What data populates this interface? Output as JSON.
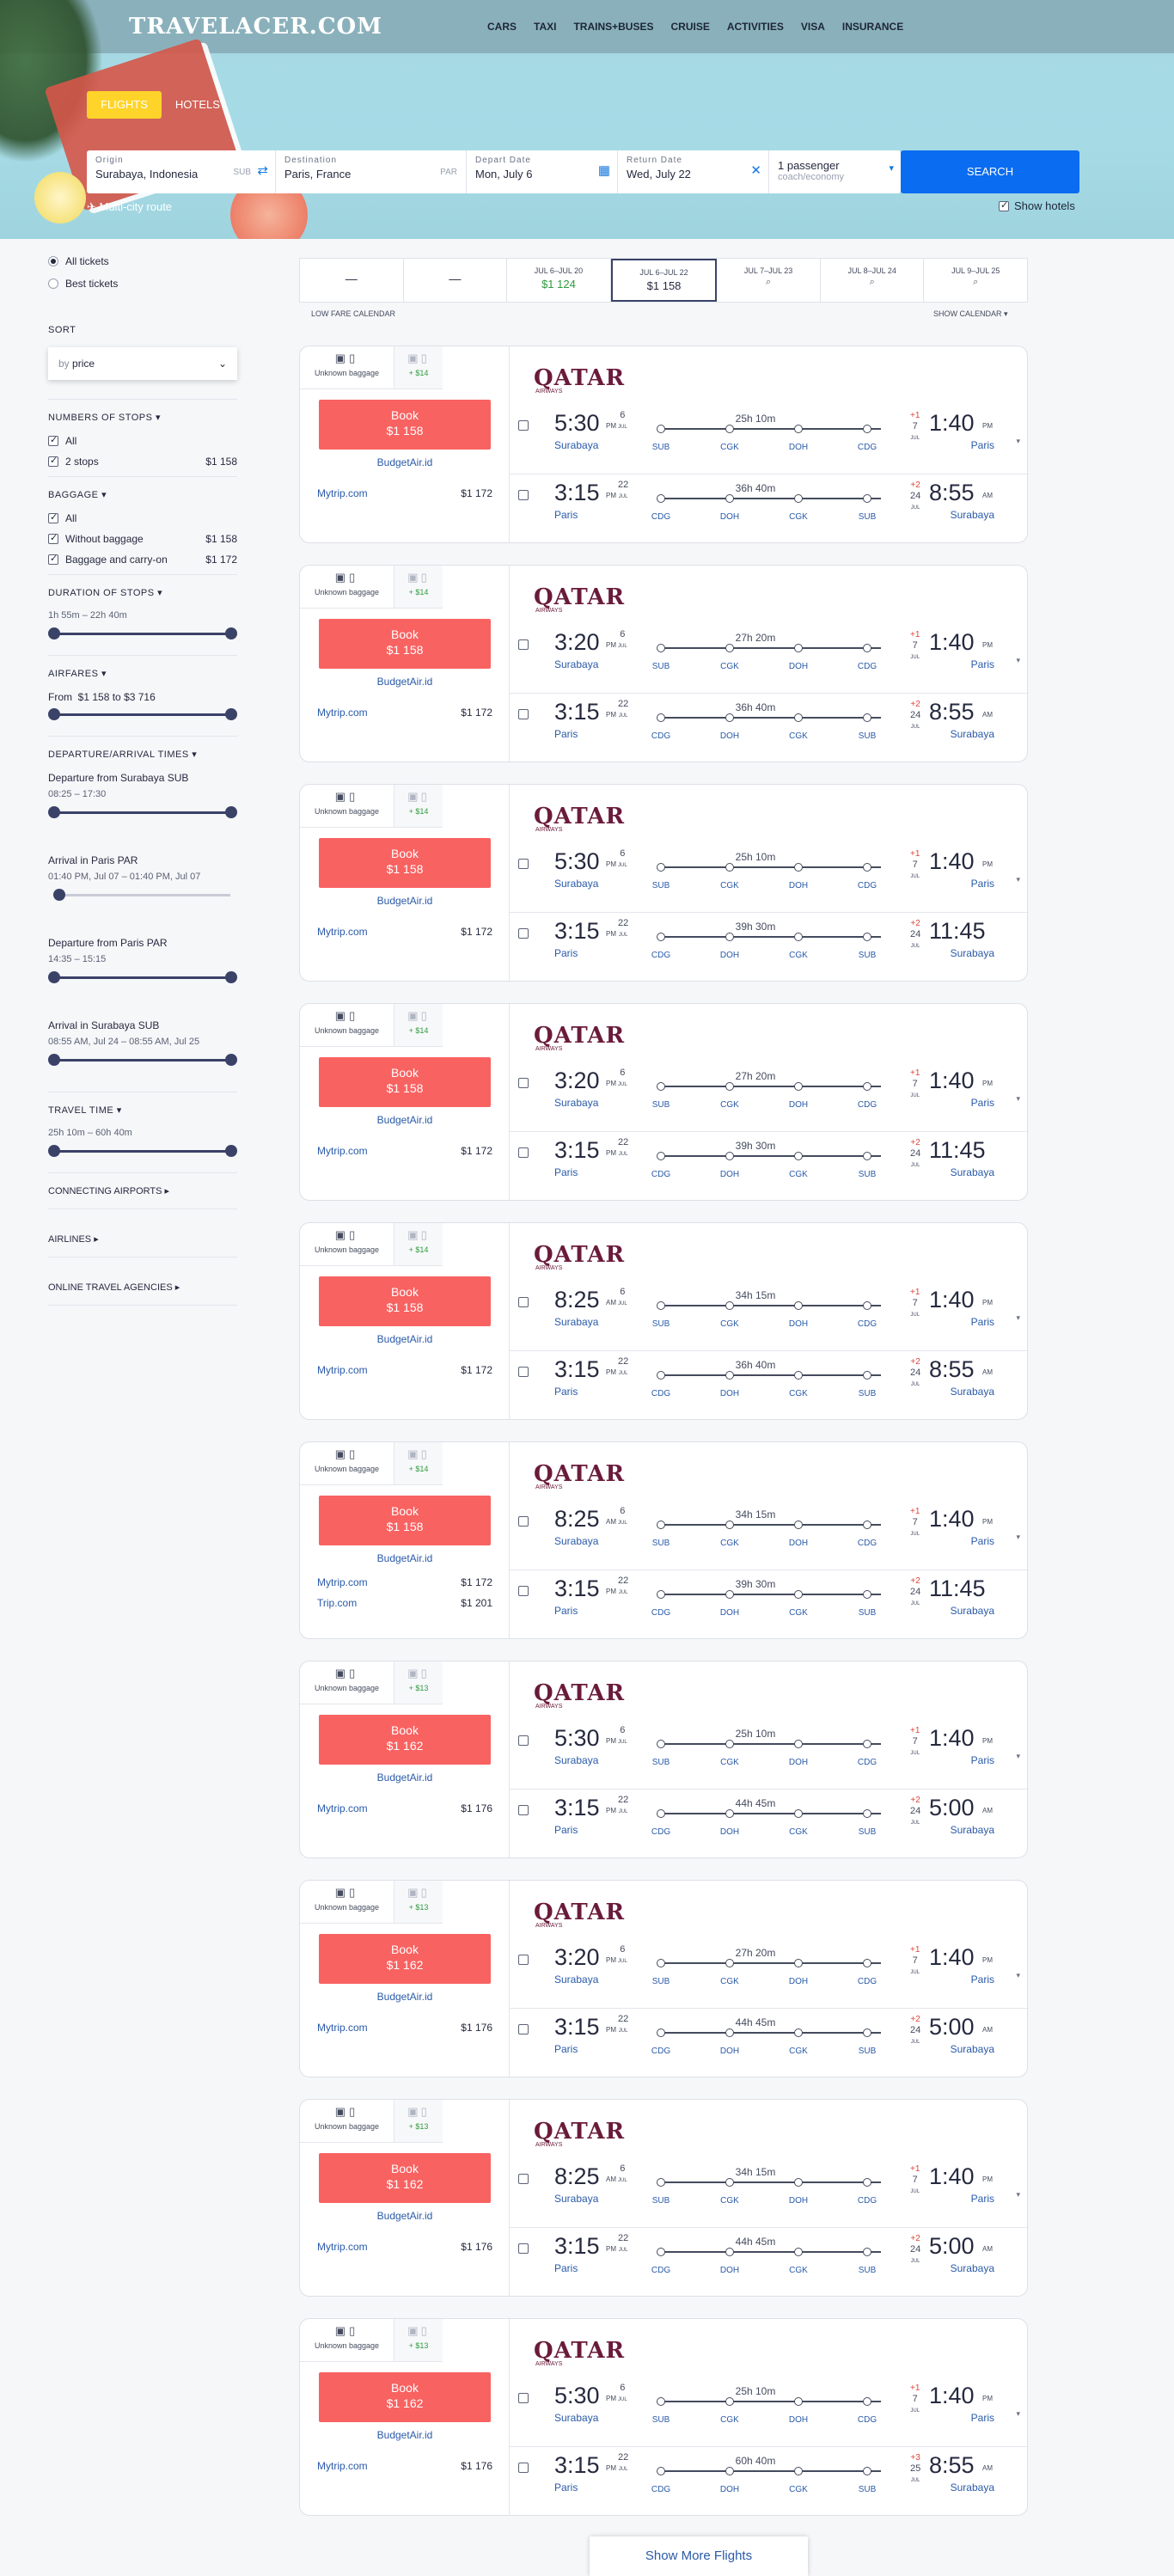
{
  "brand": {
    "logo": "TRAVELACER.COM"
  },
  "nav": [
    "CARS",
    "TAXI",
    "TRAINS+BUSES",
    "CRUISE",
    "ACTIVITIES",
    "VISA",
    "INSURANCE"
  ],
  "tabs": [
    {
      "label": "FLIGHTS",
      "active": true
    },
    {
      "label": "HOTELS",
      "active": false
    }
  ],
  "search": {
    "origin_label": "Origin",
    "origin_value": "Surabaya, Indonesia",
    "origin_code": "SUB",
    "destination_label": "Destination",
    "destination_value": "Paris, France",
    "destination_code": "PAR",
    "depart_label": "Depart Date",
    "depart_value": "Mon, July 6",
    "return_label": "Return Date",
    "return_value": "Wed, July 22",
    "passengers_value": "1 passenger",
    "class_value": "coach/economy",
    "search_label": "SEARCH",
    "multicity_label": "Multi-city route",
    "show_hotels_label": "Show hotels",
    "accent": "#0a6cf0"
  },
  "sidebar": {
    "ticket_types": [
      {
        "label": "All tickets",
        "selected": true
      },
      {
        "label": "Best tickets",
        "selected": false
      }
    ],
    "sort_heading": "SORT",
    "sort_prefix": "by",
    "sort_value": "price",
    "stops_heading": "NUMBERS OF STOPS",
    "stops": [
      {
        "label": "All",
        "price": ""
      },
      {
        "label": "2 stops",
        "price": "$1 158"
      }
    ],
    "baggage_heading": "BAGGAGE",
    "baggage": [
      {
        "label": "All",
        "price": ""
      },
      {
        "label": "Without baggage",
        "price": "$1 158"
      },
      {
        "label": "Baggage and carry-on",
        "price": "$1 172"
      }
    ],
    "duration_heading": "DURATION OF STOPS",
    "duration_range": "1h 55m – 22h 40m",
    "airfares_heading": "AIRFARES",
    "airfares_from": "From",
    "airfares_min": "$1 158",
    "airfares_to": "to",
    "airfares_max": "$3 716",
    "times_heading": "DEPARTURE/ARRIVAL TIMES",
    "time_filters": [
      {
        "label": "Departure from Surabaya SUB",
        "range": "08:25 – 17:30"
      },
      {
        "label": "Arrival in Paris PAR",
        "range": "01:40 PM, Jul 07 – 01:40 PM, Jul 07"
      },
      {
        "label": "Departure from Paris PAR",
        "range": "14:35 – 15:15"
      },
      {
        "label": "Arrival in Surabaya SUB",
        "range": "08:55 AM, Jul 24 – 08:55 AM, Jul 25"
      }
    ],
    "travel_time_heading": "TRAVEL TIME",
    "travel_time_range": "25h 10m – 60h 40m",
    "connecting_heading": "CONNECTING AIRPORTS",
    "airlines_heading": "AIRLINES",
    "agencies_heading": "ONLINE TRAVEL AGENCIES"
  },
  "calendar": {
    "cells": [
      {
        "date": "",
        "price": "—",
        "type": "dash"
      },
      {
        "date": "",
        "price": "—",
        "type": "dash"
      },
      {
        "date": "JUL 6–JUL 20",
        "price": "$1 124",
        "type": "green"
      },
      {
        "date": "JUL 6–JUL 22",
        "price": "$1 158",
        "type": "selected"
      },
      {
        "date": "JUL 7–JUL 23",
        "price": "",
        "type": "search"
      },
      {
        "date": "JUL 8–JUL 24",
        "price": "",
        "type": "search"
      },
      {
        "date": "JUL 9–JUL 25",
        "price": "",
        "type": "search"
      }
    ],
    "low_fare_label": "LOW FARE CALENDAR",
    "show_calendar_label": "SHOW CALENDAR"
  },
  "card_common": {
    "baggage_label": "Unknown baggage",
    "book_label": "Book",
    "airline_name": "QATAR",
    "airline_sub": "AIRWAYS"
  },
  "flights": [
    {
      "extra": "+ $14",
      "price": "$1 158",
      "agency": "BudgetAir.id",
      "others": [
        {
          "name": "Mytrip.com",
          "price": "$1 172"
        }
      ],
      "out": {
        "dep": "5:30",
        "dep_ampm": "PM",
        "dep_day": "6",
        "dep_city": "Surabaya",
        "dur": "25h 10m",
        "stops": [
          "SUB",
          "CGK",
          "DOH",
          "CDG"
        ],
        "arr_plus": "+1",
        "arr_day": "7",
        "arr": "1:40",
        "arr_ampm": "PM",
        "arr_city": "Paris"
      },
      "ret": {
        "dep": "3:15",
        "dep_ampm": "PM",
        "dep_day": "22",
        "dep_city": "Paris",
        "dur": "36h 40m",
        "stops": [
          "CDG",
          "DOH",
          "CGK",
          "SUB"
        ],
        "arr_plus": "+2",
        "arr_day": "24",
        "arr": "8:55",
        "arr_ampm": "AM",
        "arr_city": "Surabaya"
      }
    },
    {
      "extra": "+ $14",
      "price": "$1 158",
      "agency": "BudgetAir.id",
      "others": [
        {
          "name": "Mytrip.com",
          "price": "$1 172"
        }
      ],
      "out": {
        "dep": "3:20",
        "dep_ampm": "PM",
        "dep_day": "6",
        "dep_city": "Surabaya",
        "dur": "27h 20m",
        "stops": [
          "SUB",
          "CGK",
          "DOH",
          "CDG"
        ],
        "arr_plus": "+1",
        "arr_day": "7",
        "arr": "1:40",
        "arr_ampm": "PM",
        "arr_city": "Paris"
      },
      "ret": {
        "dep": "3:15",
        "dep_ampm": "PM",
        "dep_day": "22",
        "dep_city": "Paris",
        "dur": "36h 40m",
        "stops": [
          "CDG",
          "DOH",
          "CGK",
          "SUB"
        ],
        "arr_plus": "+2",
        "arr_day": "24",
        "arr": "8:55",
        "arr_ampm": "AM",
        "arr_city": "Surabaya"
      }
    },
    {
      "extra": "+ $14",
      "price": "$1 158",
      "agency": "BudgetAir.id",
      "others": [
        {
          "name": "Mytrip.com",
          "price": "$1 172"
        }
      ],
      "out": {
        "dep": "5:30",
        "dep_ampm": "PM",
        "dep_day": "6",
        "dep_city": "Surabaya",
        "dur": "25h 10m",
        "stops": [
          "SUB",
          "CGK",
          "DOH",
          "CDG"
        ],
        "arr_plus": "+1",
        "arr_day": "7",
        "arr": "1:40",
        "arr_ampm": "PM",
        "arr_city": "Paris"
      },
      "ret": {
        "dep": "3:15",
        "dep_ampm": "PM",
        "dep_day": "22",
        "dep_city": "Paris",
        "dur": "39h 30m",
        "stops": [
          "CDG",
          "DOH",
          "CGK",
          "SUB"
        ],
        "arr_plus": "+2",
        "arr_day": "24",
        "arr": "11:45",
        "arr_ampm": "",
        "arr_city": "Surabaya"
      }
    },
    {
      "extra": "+ $14",
      "price": "$1 158",
      "agency": "BudgetAir.id",
      "others": [
        {
          "name": "Mytrip.com",
          "price": "$1 172"
        }
      ],
      "out": {
        "dep": "3:20",
        "dep_ampm": "PM",
        "dep_day": "6",
        "dep_city": "Surabaya",
        "dur": "27h 20m",
        "stops": [
          "SUB",
          "CGK",
          "DOH",
          "CDG"
        ],
        "arr_plus": "+1",
        "arr_day": "7",
        "arr": "1:40",
        "arr_ampm": "PM",
        "arr_city": "Paris"
      },
      "ret": {
        "dep": "3:15",
        "dep_ampm": "PM",
        "dep_day": "22",
        "dep_city": "Paris",
        "dur": "39h 30m",
        "stops": [
          "CDG",
          "DOH",
          "CGK",
          "SUB"
        ],
        "arr_plus": "+2",
        "arr_day": "24",
        "arr": "11:45",
        "arr_ampm": "",
        "arr_city": "Surabaya"
      }
    },
    {
      "extra": "+ $14",
      "price": "$1 158",
      "agency": "BudgetAir.id",
      "others": [
        {
          "name": "Mytrip.com",
          "price": "$1 172"
        }
      ],
      "out": {
        "dep": "8:25",
        "dep_ampm": "AM",
        "dep_day": "6",
        "dep_city": "Surabaya",
        "dur": "34h 15m",
        "stops": [
          "SUB",
          "CGK",
          "DOH",
          "CDG"
        ],
        "arr_plus": "+1",
        "arr_day": "7",
        "arr": "1:40",
        "arr_ampm": "PM",
        "arr_city": "Paris"
      },
      "ret": {
        "dep": "3:15",
        "dep_ampm": "PM",
        "dep_day": "22",
        "dep_city": "Paris",
        "dur": "36h 40m",
        "stops": [
          "CDG",
          "DOH",
          "CGK",
          "SUB"
        ],
        "arr_plus": "+2",
        "arr_day": "24",
        "arr": "8:55",
        "arr_ampm": "AM",
        "arr_city": "Surabaya"
      }
    },
    {
      "extra": "+ $14",
      "price": "$1 158",
      "agency": "BudgetAir.id",
      "others": [
        {
          "name": "Mytrip.com",
          "price": "$1 172"
        },
        {
          "name": "Trip.com",
          "price": "$1 201"
        }
      ],
      "out": {
        "dep": "8:25",
        "dep_ampm": "AM",
        "dep_day": "6",
        "dep_city": "Surabaya",
        "dur": "34h 15m",
        "stops": [
          "SUB",
          "CGK",
          "DOH",
          "CDG"
        ],
        "arr_plus": "+1",
        "arr_day": "7",
        "arr": "1:40",
        "arr_ampm": "PM",
        "arr_city": "Paris"
      },
      "ret": {
        "dep": "3:15",
        "dep_ampm": "PM",
        "dep_day": "22",
        "dep_city": "Paris",
        "dur": "39h 30m",
        "stops": [
          "CDG",
          "DOH",
          "CGK",
          "SUB"
        ],
        "arr_plus": "+2",
        "arr_day": "24",
        "arr": "11:45",
        "arr_ampm": "",
        "arr_city": "Surabaya"
      }
    },
    {
      "extra": "+ $13",
      "price": "$1 162",
      "agency": "BudgetAir.id",
      "others": [
        {
          "name": "Mytrip.com",
          "price": "$1 176"
        }
      ],
      "out": {
        "dep": "5:30",
        "dep_ampm": "PM",
        "dep_day": "6",
        "dep_city": "Surabaya",
        "dur": "25h 10m",
        "stops": [
          "SUB",
          "CGK",
          "DOH",
          "CDG"
        ],
        "arr_plus": "+1",
        "arr_day": "7",
        "arr": "1:40",
        "arr_ampm": "PM",
        "arr_city": "Paris"
      },
      "ret": {
        "dep": "3:15",
        "dep_ampm": "PM",
        "dep_day": "22",
        "dep_city": "Paris",
        "dur": "44h 45m",
        "stops": [
          "CDG",
          "DOH",
          "CGK",
          "SUB"
        ],
        "arr_plus": "+2",
        "arr_day": "24",
        "arr": "5:00",
        "arr_ampm": "AM",
        "arr_city": "Surabaya"
      }
    },
    {
      "extra": "+ $13",
      "price": "$1 162",
      "agency": "BudgetAir.id",
      "others": [
        {
          "name": "Mytrip.com",
          "price": "$1 176"
        }
      ],
      "out": {
        "dep": "3:20",
        "dep_ampm": "PM",
        "dep_day": "6",
        "dep_city": "Surabaya",
        "dur": "27h 20m",
        "stops": [
          "SUB",
          "CGK",
          "DOH",
          "CDG"
        ],
        "arr_plus": "+1",
        "arr_day": "7",
        "arr": "1:40",
        "arr_ampm": "PM",
        "arr_city": "Paris"
      },
      "ret": {
        "dep": "3:15",
        "dep_ampm": "PM",
        "dep_day": "22",
        "dep_city": "Paris",
        "dur": "44h 45m",
        "stops": [
          "CDG",
          "DOH",
          "CGK",
          "SUB"
        ],
        "arr_plus": "+2",
        "arr_day": "24",
        "arr": "5:00",
        "arr_ampm": "AM",
        "arr_city": "Surabaya"
      }
    },
    {
      "extra": "+ $13",
      "price": "$1 162",
      "agency": "BudgetAir.id",
      "others": [
        {
          "name": "Mytrip.com",
          "price": "$1 176"
        }
      ],
      "out": {
        "dep": "8:25",
        "dep_ampm": "AM",
        "dep_day": "6",
        "dep_city": "Surabaya",
        "dur": "34h 15m",
        "stops": [
          "SUB",
          "CGK",
          "DOH",
          "CDG"
        ],
        "arr_plus": "+1",
        "arr_day": "7",
        "arr": "1:40",
        "arr_ampm": "PM",
        "arr_city": "Paris"
      },
      "ret": {
        "dep": "3:15",
        "dep_ampm": "PM",
        "dep_day": "22",
        "dep_city": "Paris",
        "dur": "44h 45m",
        "stops": [
          "CDG",
          "DOH",
          "CGK",
          "SUB"
        ],
        "arr_plus": "+2",
        "arr_day": "24",
        "arr": "5:00",
        "arr_ampm": "AM",
        "arr_city": "Surabaya"
      }
    },
    {
      "extra": "+ $13",
      "price": "$1 162",
      "agency": "BudgetAir.id",
      "others": [
        {
          "name": "Mytrip.com",
          "price": "$1 176"
        }
      ],
      "out": {
        "dep": "5:30",
        "dep_ampm": "PM",
        "dep_day": "6",
        "dep_city": "Surabaya",
        "dur": "25h 10m",
        "stops": [
          "SUB",
          "CGK",
          "DOH",
          "CDG"
        ],
        "arr_plus": "+1",
        "arr_day": "7",
        "arr": "1:40",
        "arr_ampm": "PM",
        "arr_city": "Paris"
      },
      "ret": {
        "dep": "3:15",
        "dep_ampm": "PM",
        "dep_day": "22",
        "dep_city": "Paris",
        "dur": "60h 40m",
        "stops": [
          "CDG",
          "DOH",
          "CGK",
          "SUB"
        ],
        "arr_plus": "+3",
        "arr_day": "25",
        "arr": "8:55",
        "arr_ampm": "AM",
        "arr_city": "Surabaya"
      }
    }
  ],
  "month_label": "JUL",
  "show_more_label": "Show More Flights",
  "colors": {
    "book": "#f86261",
    "link": "#2a5aa8",
    "green": "#2e9b3e",
    "plus": "#e0443a"
  }
}
